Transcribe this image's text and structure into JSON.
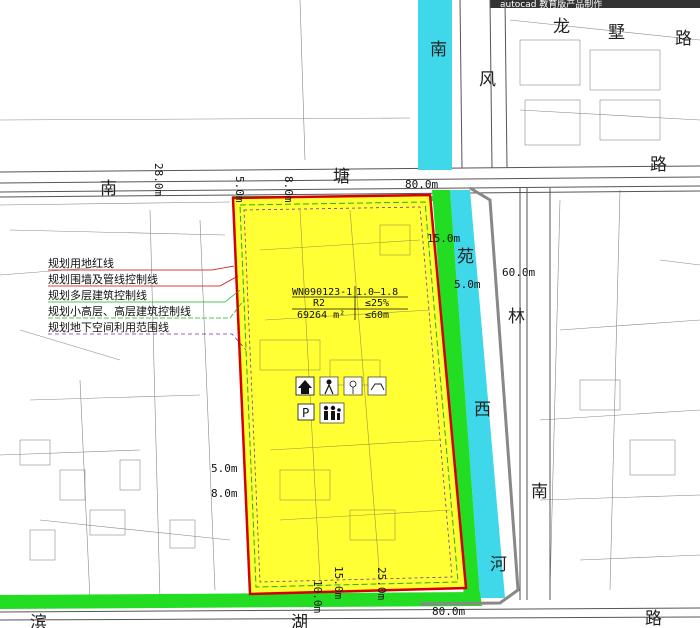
{
  "header": {
    "partial_label": "autocad 教育版产品制作"
  },
  "roads": {
    "nanfeng": [
      "南",
      "风"
    ],
    "longshu": [
      "龙",
      "墅",
      "路"
    ],
    "north_road": [
      "南",
      "塘",
      "路"
    ],
    "west_river": [
      "苑",
      "林",
      "西",
      "南",
      "河"
    ],
    "south_road": [
      "滨",
      "湖",
      "路"
    ]
  },
  "dimensions": {
    "d_28m": "28.0m",
    "d_80m_north": "80.0m",
    "d_80m_south": "80.0m",
    "d_60m": "60.0m",
    "d_15m_ne": "15.0m",
    "d_5m_ne": "5.0m",
    "d_5m_w": "5.0m",
    "d_8m_w": "8.0m",
    "d_5m_top": "5.0m",
    "d_8m_top": "8.0m",
    "d_15m_s": "15.0m",
    "d_10m_s": "10.0m",
    "d_25m_s": "25.0m"
  },
  "legend": [
    {
      "label": "规划用地红线",
      "color": "#d40000"
    },
    {
      "label": "规划围墙及管线控制线",
      "color": "#d40000"
    },
    {
      "label": "规划多层建筑控制线",
      "color": "#20b020"
    },
    {
      "label": "规划小高层、高层建筑控制线",
      "color": "#20b020"
    },
    {
      "label": "规划地下空间利用范围线",
      "color": "#7030a0"
    }
  ],
  "parcel": {
    "code": "WN090123-1",
    "far": "1.0—1.8",
    "use": "R2",
    "coverage": "≤25%",
    "area": "69264 m²",
    "height": "≤60m"
  },
  "icons": [
    "house-icon",
    "person-icon",
    "flower-icon",
    "dog-icon",
    "parking-icon",
    "family-icon"
  ],
  "colors": {
    "plot_fill": "#ffff33",
    "river": "#3fd8ea",
    "green_belt": "#22dd22",
    "red_line": "#d40000"
  }
}
